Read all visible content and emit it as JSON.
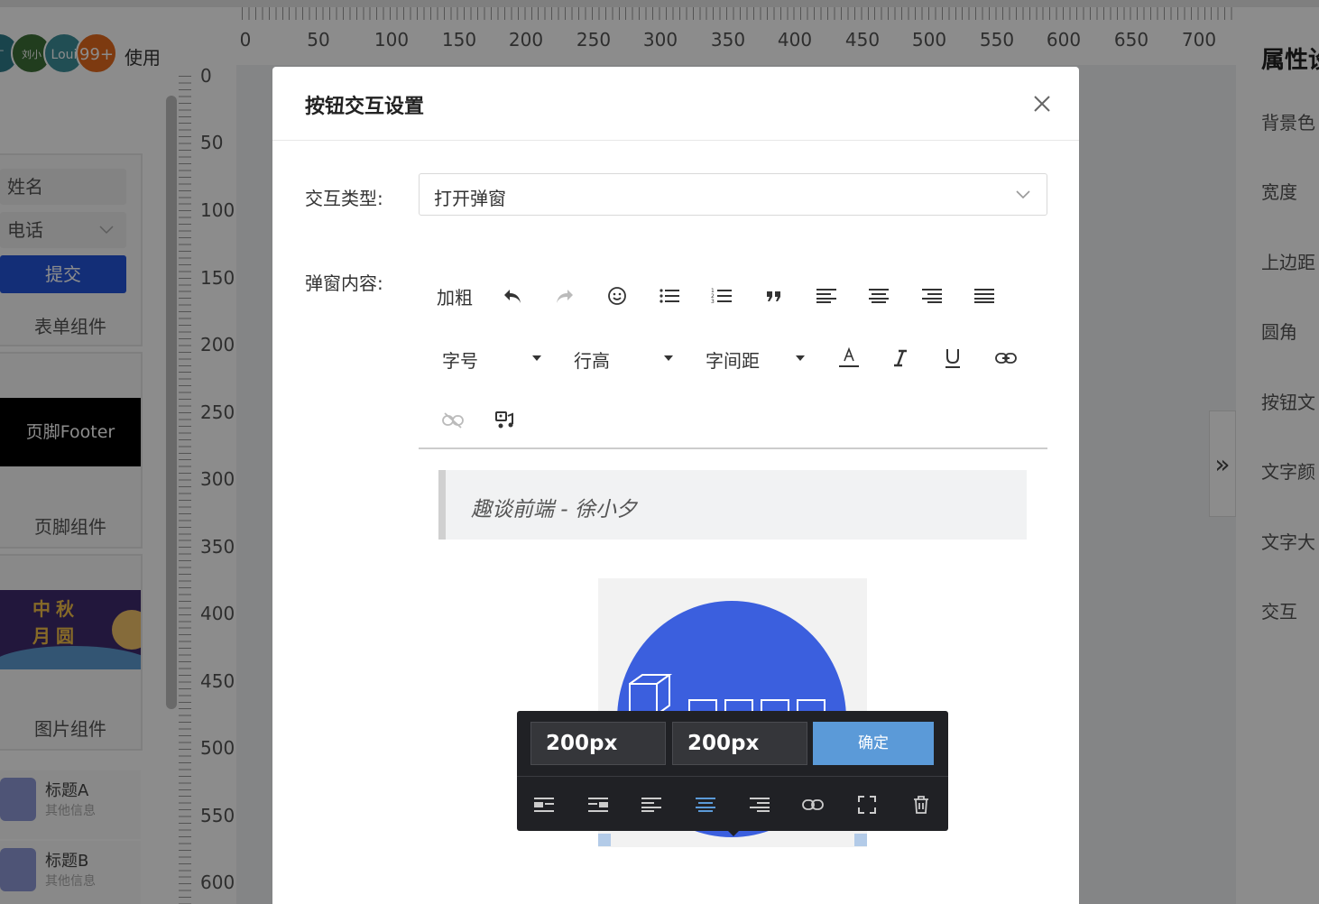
{
  "left_panel": {
    "avatars": [
      {
        "label": "丁"
      },
      {
        "label": "刘小"
      },
      {
        "label": "Loui"
      },
      {
        "label": "99+"
      }
    ],
    "use_label": "使用",
    "form_component": {
      "field_name": "姓名",
      "field_phone": "电话",
      "submit": "提交",
      "label": "表单组件"
    },
    "footer_component": {
      "block_text": "页脚Footer",
      "label": "页脚组件"
    },
    "image_component": {
      "banner_text_1": "中秋",
      "banner_text_2": "月圆",
      "label": "图片组件"
    },
    "list_items": [
      {
        "title": "标题A",
        "subtitle": "其他信息"
      },
      {
        "title": "标题B",
        "subtitle": "其他信息"
      }
    ]
  },
  "ruler": {
    "top_numbers": [
      "0",
      "50",
      "100",
      "150",
      "200",
      "250",
      "300",
      "350",
      "400",
      "450",
      "500",
      "550",
      "600",
      "650",
      "700"
    ],
    "left_numbers": [
      "0",
      "50",
      "100",
      "150",
      "200",
      "250",
      "300",
      "350",
      "400",
      "450",
      "500",
      "550",
      "600"
    ]
  },
  "right_panel": {
    "title": "属性设",
    "items": [
      "背景色",
      "宽度",
      "上边距",
      "圆角",
      "按钮文",
      "文字颜",
      "文字大",
      "交互"
    ],
    "collapse_icon": "»"
  },
  "modal": {
    "title": "按钮交互设置",
    "interaction_type_label": "交互类型:",
    "interaction_type_value": "打开弹窗",
    "popup_content_label": "弹窗内容:",
    "toolbar": {
      "bold": "加粗",
      "font_size": "字号",
      "line_height": "行高",
      "letter_spacing": "字间距"
    },
    "editor": {
      "quote_text": "趣谈前端 - 徐小夕"
    },
    "image_popover": {
      "width_value": "200px",
      "height_value": "200px",
      "confirm": "确定"
    }
  },
  "colors": {
    "primary": "#2454d9",
    "circle": "#3b5fde",
    "popover_bg": "#202125",
    "confirm_btn": "#5b9ad8",
    "active_align": "#5b9ad8"
  }
}
